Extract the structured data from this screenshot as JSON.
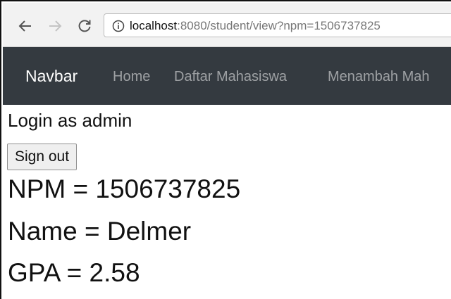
{
  "browser": {
    "url_host": "localhost",
    "url_rest": ":8080/student/view?npm=1506737825",
    "icons": {
      "back": "arrow-left-icon",
      "forward": "arrow-right-icon",
      "reload": "reload-icon",
      "info": "info-icon"
    }
  },
  "navbar": {
    "brand": "Navbar",
    "links": [
      {
        "label": "Home"
      },
      {
        "label": "Daftar Mahasiswa"
      },
      {
        "label": "Menambah Mah"
      }
    ],
    "background": "#343a40"
  },
  "main": {
    "login_text": "Login as admin",
    "signout_label": "Sign out",
    "npm_line": "NPM = 1506737825",
    "name_line": "Name = Delmer",
    "gpa_line": "GPA = 2.58"
  }
}
